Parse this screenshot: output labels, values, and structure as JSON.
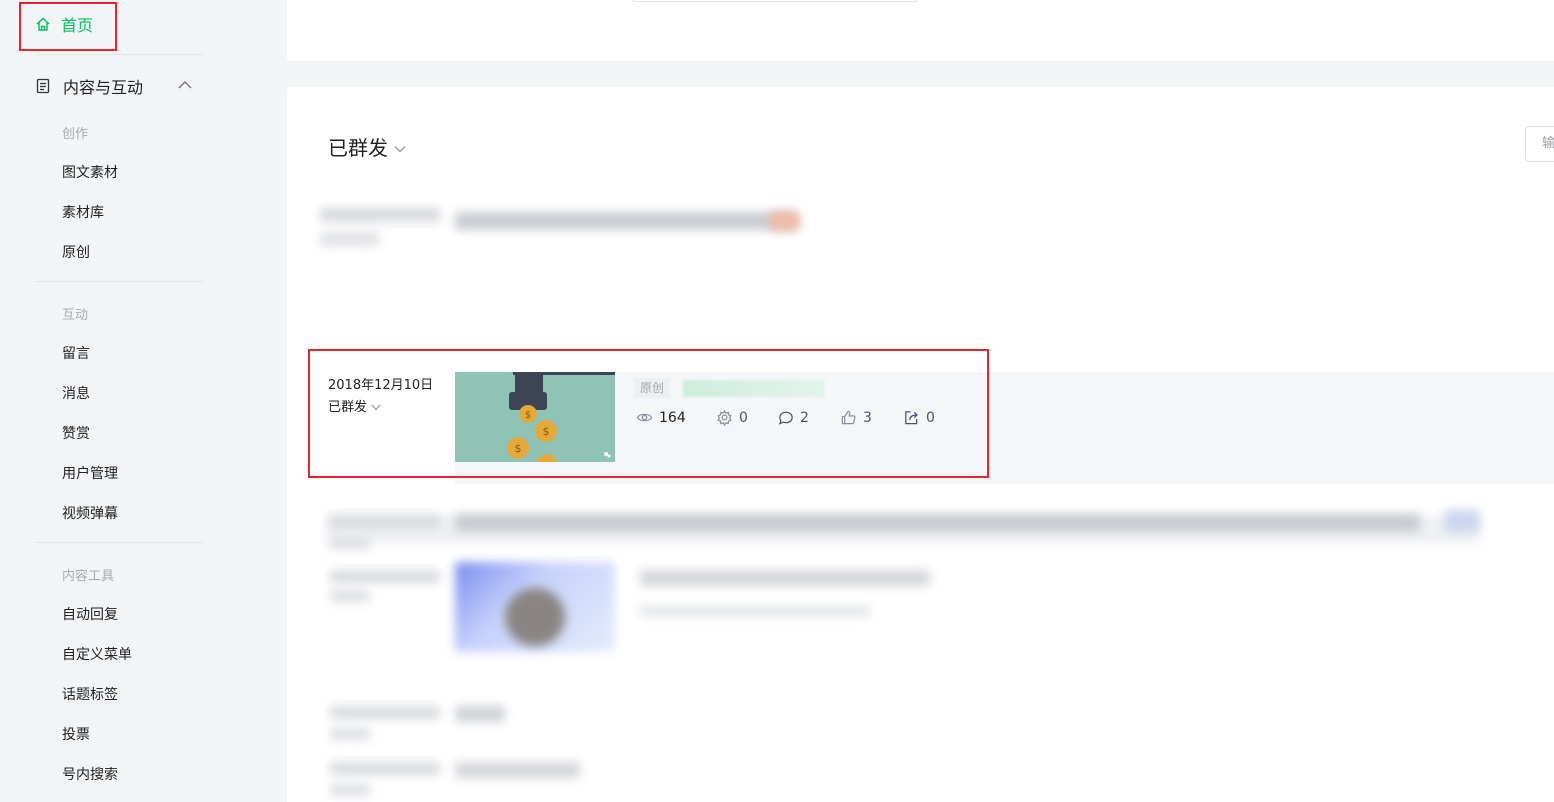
{
  "sidebar": {
    "home_label": "首页",
    "group_label": "内容与互动",
    "sections": {
      "create": "创作",
      "interact": "互动",
      "tools": "内容工具"
    },
    "create_items": [
      "图文素材",
      "素材库",
      "原创"
    ],
    "interact_items": [
      "留言",
      "消息",
      "赞赏",
      "用户管理",
      "视频弹幕"
    ],
    "tool_items": [
      "自动回复",
      "自定义菜单",
      "话题标签",
      "投票",
      "号内搜索"
    ]
  },
  "main": {
    "filter_label": "已群发",
    "search_placeholder": "输",
    "highlighted_post": {
      "date": "2018年12月10日",
      "status": "已群发",
      "tag": "原创",
      "stats": {
        "reads": "164",
        "recommends": "0",
        "comments": "2",
        "likes": "3",
        "shares": "0"
      }
    }
  },
  "colors": {
    "accent": "#07c160",
    "highlight_frame": "#e5252f",
    "stat_text": "#4a5170",
    "thumb_bg": "#8fc3b6"
  },
  "icons": [
    "home-icon",
    "document-icon",
    "chevron-up-icon",
    "chevron-down-icon",
    "eye-icon",
    "gear-icon",
    "comment-icon",
    "thumbs-up-icon",
    "share-icon"
  ]
}
